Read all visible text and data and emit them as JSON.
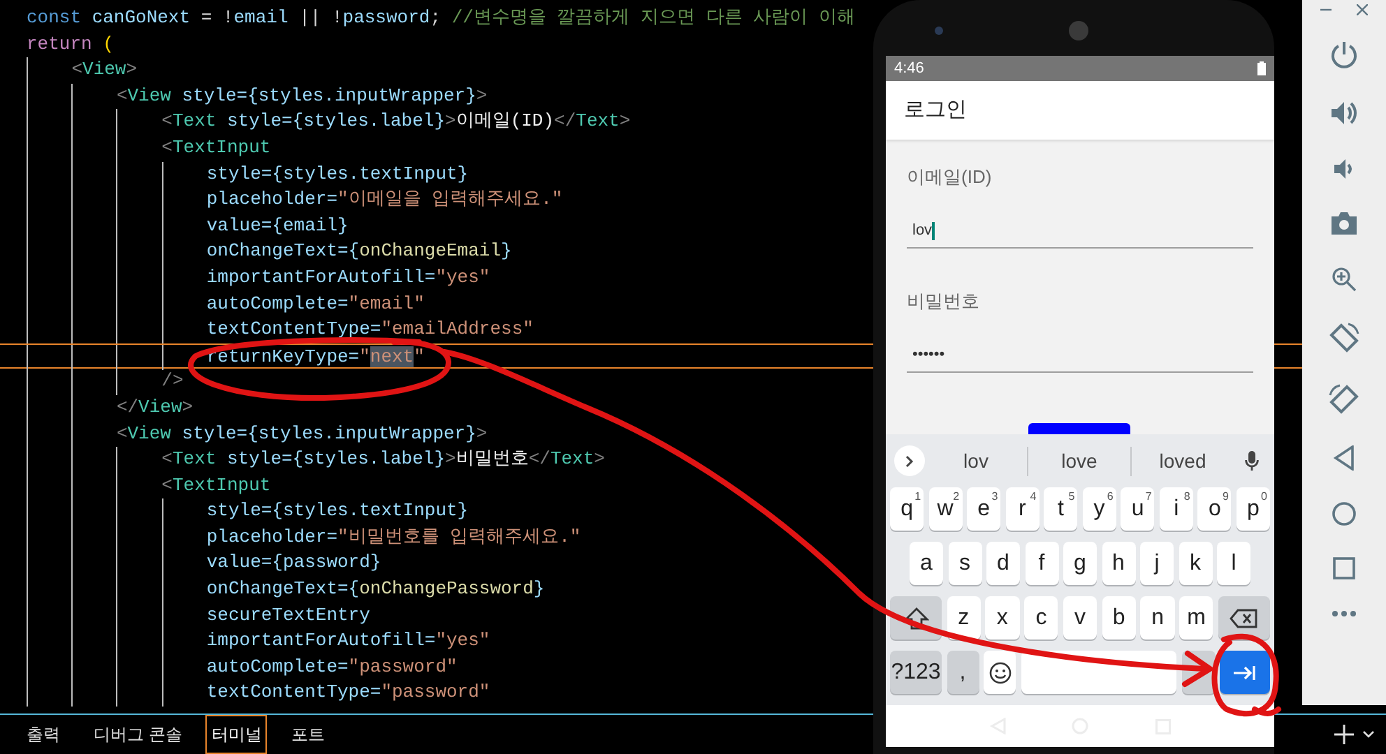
{
  "editor": {
    "lines": [
      {
        "current": false,
        "tokens": [
          {
            "kind": "kw",
            "text": "const"
          },
          {
            "kind": "var",
            "text": " canGoNext"
          },
          {
            "kind": "op",
            "text": " = !"
          },
          {
            "kind": "var",
            "text": "email"
          },
          {
            "kind": "op",
            "text": " || !"
          },
          {
            "kind": "var",
            "text": "password"
          },
          {
            "kind": "op",
            "text": "; "
          },
          {
            "kind": "comment",
            "text": "//변수명을 깔끔하게 지으면 다른 사람이 이해"
          }
        ]
      },
      {
        "current": false,
        "tokens": [
          {
            "kind": "ctrl",
            "text": "return"
          },
          {
            "kind": "paren",
            "text": " ("
          }
        ]
      },
      {
        "current": false,
        "tokens": [
          {
            "kind": "punct",
            "text": "    <"
          },
          {
            "kind": "tag",
            "text": "View"
          },
          {
            "kind": "punct",
            "text": ">"
          }
        ]
      },
      {
        "current": false,
        "tokens": [
          {
            "kind": "punct",
            "text": "        <"
          },
          {
            "kind": "tag",
            "text": "View"
          },
          {
            "kind": "var",
            "text": " style={styles.inputWrapper}"
          },
          {
            "kind": "punct",
            "text": ">"
          }
        ]
      },
      {
        "current": false,
        "tokens": [
          {
            "kind": "punct",
            "text": "            <"
          },
          {
            "kind": "tag",
            "text": "Text"
          },
          {
            "kind": "var",
            "text": " style={styles.label}"
          },
          {
            "kind": "punct",
            "text": ">"
          },
          {
            "kind": "text",
            "text": "이메일(ID)"
          },
          {
            "kind": "punct",
            "text": "</"
          },
          {
            "kind": "tag",
            "text": "Text"
          },
          {
            "kind": "punct",
            "text": ">"
          }
        ]
      },
      {
        "current": false,
        "tokens": [
          {
            "kind": "punct",
            "text": "            <"
          },
          {
            "kind": "tag",
            "text": "TextInput"
          }
        ]
      },
      {
        "current": false,
        "tokens": [
          {
            "kind": "var",
            "text": "                style={styles.textInput}"
          }
        ]
      },
      {
        "current": false,
        "tokens": [
          {
            "kind": "var",
            "text": "                placeholder="
          },
          {
            "kind": "str",
            "text": "\"이메일을 입력해주세요.\""
          }
        ]
      },
      {
        "current": false,
        "tokens": [
          {
            "kind": "var",
            "text": "                value={email}"
          }
        ]
      },
      {
        "current": false,
        "tokens": [
          {
            "kind": "var",
            "text": "                onChangeText={"
          },
          {
            "kind": "fn",
            "text": "onChangeEmail"
          },
          {
            "kind": "var",
            "text": "}"
          }
        ]
      },
      {
        "current": false,
        "tokens": [
          {
            "kind": "var",
            "text": "                importantForAutofill="
          },
          {
            "kind": "str",
            "text": "\"yes\""
          }
        ]
      },
      {
        "current": false,
        "tokens": [
          {
            "kind": "var",
            "text": "                autoComplete="
          },
          {
            "kind": "str",
            "text": "\"email\""
          }
        ]
      },
      {
        "current": false,
        "tokens": [
          {
            "kind": "var",
            "text": "                textContentType="
          },
          {
            "kind": "str",
            "text": "\"emailAddress\""
          }
        ]
      },
      {
        "current": true,
        "tokens": [
          {
            "kind": "var",
            "text": "                returnKeyType="
          },
          {
            "kind": "str",
            "text": "\""
          },
          {
            "kind": "match",
            "text": "next"
          },
          {
            "kind": "str",
            "text": "\""
          }
        ]
      },
      {
        "current": false,
        "tokens": [
          {
            "kind": "punct",
            "text": "            />"
          }
        ]
      },
      {
        "current": false,
        "tokens": [
          {
            "kind": "punct",
            "text": "        </"
          },
          {
            "kind": "tag",
            "text": "View"
          },
          {
            "kind": "punct",
            "text": ">"
          }
        ]
      },
      {
        "current": false,
        "tokens": [
          {
            "kind": "punct",
            "text": "        <"
          },
          {
            "kind": "tag",
            "text": "View"
          },
          {
            "kind": "var",
            "text": " style={styles.inputWrapper}"
          },
          {
            "kind": "punct",
            "text": ">"
          }
        ]
      },
      {
        "current": false,
        "tokens": [
          {
            "kind": "punct",
            "text": "            <"
          },
          {
            "kind": "tag",
            "text": "Text"
          },
          {
            "kind": "var",
            "text": " style={styles.label}"
          },
          {
            "kind": "punct",
            "text": ">"
          },
          {
            "kind": "text",
            "text": "비밀번호"
          },
          {
            "kind": "punct",
            "text": "</"
          },
          {
            "kind": "tag",
            "text": "Text"
          },
          {
            "kind": "punct",
            "text": ">"
          }
        ]
      },
      {
        "current": false,
        "tokens": [
          {
            "kind": "punct",
            "text": "            <"
          },
          {
            "kind": "tag",
            "text": "TextInput"
          }
        ]
      },
      {
        "current": false,
        "tokens": [
          {
            "kind": "var",
            "text": "                style={styles.textInput}"
          }
        ]
      },
      {
        "current": false,
        "tokens": [
          {
            "kind": "var",
            "text": "                placeholder="
          },
          {
            "kind": "str",
            "text": "\"비밀번호를 입력해주세요.\""
          }
        ]
      },
      {
        "current": false,
        "tokens": [
          {
            "kind": "var",
            "text": "                value={password}"
          }
        ]
      },
      {
        "current": false,
        "tokens": [
          {
            "kind": "var",
            "text": "                onChangeText={"
          },
          {
            "kind": "fn",
            "text": "onChangePassword"
          },
          {
            "kind": "var",
            "text": "}"
          }
        ]
      },
      {
        "current": false,
        "tokens": [
          {
            "kind": "var",
            "text": "                secureTextEntry"
          }
        ]
      },
      {
        "current": false,
        "tokens": [
          {
            "kind": "var",
            "text": "                importantForAutofill="
          },
          {
            "kind": "str",
            "text": "\"yes\""
          }
        ]
      },
      {
        "current": false,
        "tokens": [
          {
            "kind": "var",
            "text": "                autoComplete="
          },
          {
            "kind": "str",
            "text": "\"password\""
          }
        ]
      },
      {
        "current": false,
        "tokens": [
          {
            "kind": "var",
            "text": "                textContentType="
          },
          {
            "kind": "str",
            "text": "\"password\""
          }
        ]
      }
    ]
  },
  "panel": {
    "tabs": [
      {
        "label": "출력",
        "selected": false
      },
      {
        "label": "디버그 콘솔",
        "selected": false
      },
      {
        "label": "터미널",
        "selected": true
      },
      {
        "label": "포트",
        "selected": false
      }
    ]
  },
  "emulator": {
    "status_bar": {
      "time": "4:46"
    },
    "app_bar": {
      "title": "로그인"
    },
    "fields": [
      {
        "label": "이메일(ID)",
        "value": "lov",
        "focused": true
      },
      {
        "label": "비밀번호",
        "value": "••••••",
        "focused": false
      }
    ],
    "keyboard": {
      "suggestions": [
        "lov",
        "love",
        "loved"
      ],
      "rows": [
        [
          {
            "kind": "letter",
            "label": "q",
            "hint": "1"
          },
          {
            "kind": "letter",
            "label": "w",
            "hint": "2"
          },
          {
            "kind": "letter",
            "label": "e",
            "hint": "3"
          },
          {
            "kind": "letter",
            "label": "r",
            "hint": "4"
          },
          {
            "kind": "letter",
            "label": "t",
            "hint": "5"
          },
          {
            "kind": "letter",
            "label": "y",
            "hint": "6"
          },
          {
            "kind": "letter",
            "label": "u",
            "hint": "7"
          },
          {
            "kind": "letter",
            "label": "i",
            "hint": "8"
          },
          {
            "kind": "letter",
            "label": "o",
            "hint": "9"
          },
          {
            "kind": "letter",
            "label": "p",
            "hint": "0"
          }
        ],
        [
          {
            "kind": "letter",
            "label": "a"
          },
          {
            "kind": "letter",
            "label": "s"
          },
          {
            "kind": "letter",
            "label": "d"
          },
          {
            "kind": "letter",
            "label": "f"
          },
          {
            "kind": "letter",
            "label": "g"
          },
          {
            "kind": "letter",
            "label": "h"
          },
          {
            "kind": "letter",
            "label": "j"
          },
          {
            "kind": "letter",
            "label": "k"
          },
          {
            "kind": "letter",
            "label": "l"
          }
        ],
        [
          {
            "kind": "shift"
          },
          {
            "kind": "letter",
            "label": "z"
          },
          {
            "kind": "letter",
            "label": "x"
          },
          {
            "kind": "letter",
            "label": "c"
          },
          {
            "kind": "letter",
            "label": "v"
          },
          {
            "kind": "letter",
            "label": "b"
          },
          {
            "kind": "letter",
            "label": "n"
          },
          {
            "kind": "letter",
            "label": "m"
          },
          {
            "kind": "backspace"
          }
        ],
        [
          {
            "kind": "symbols",
            "label": "?123"
          },
          {
            "kind": "comma",
            "label": ","
          },
          {
            "kind": "emoji"
          },
          {
            "kind": "space"
          },
          {
            "kind": "period"
          },
          {
            "kind": "enter"
          }
        ]
      ]
    }
  }
}
